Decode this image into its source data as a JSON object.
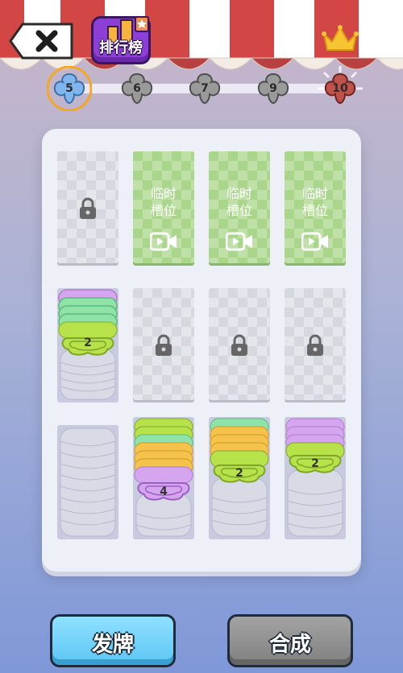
{
  "header": {
    "back_icon": "close-x-icon",
    "leaderboard_label": "排行榜",
    "crown_icon": "crown-icon"
  },
  "levels": [
    {
      "number": "5",
      "state": "current",
      "color": "#7fb6ee"
    },
    {
      "number": "6",
      "state": "locked",
      "color": "#9a9a9a"
    },
    {
      "number": "7",
      "state": "locked",
      "color": "#9a9a9a"
    },
    {
      "number": "9",
      "state": "locked",
      "color": "#9a9a9a"
    },
    {
      "number": "10",
      "state": "goal",
      "color": "#c0524a"
    }
  ],
  "slots": {
    "temp_label": "临时\n槽位",
    "temp": [
      {
        "line1": "临时",
        "line2": "槽位"
      },
      {
        "line1": "临时",
        "line2": "槽位"
      },
      {
        "line1": "临时",
        "line2": "槽位"
      }
    ]
  },
  "stacks": [
    {
      "count": "2"
    },
    {
      "count": "4"
    },
    {
      "count": "2"
    },
    {
      "count": "2"
    }
  ],
  "buttons": {
    "deal": "发牌",
    "merge": "合成"
  },
  "colors": {
    "green": "#b7e24a",
    "mint": "#8fe3a8",
    "purple": "#d6a5f0",
    "orange": "#f5c24c",
    "gray": "#d8dae6"
  }
}
